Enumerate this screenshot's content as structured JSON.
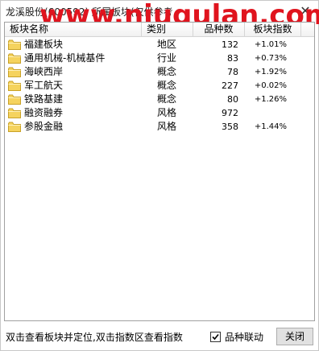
{
  "window": {
    "title": "龙溪股份(600592)  所属板块(仅供参考",
    "close_glyph": "✕"
  },
  "watermark": "www.niugulan.com",
  "columns": {
    "name": "板块名称",
    "category": "类别",
    "count": "品种数",
    "index": "板块指数"
  },
  "rows": [
    {
      "name": "福建板块",
      "category": "地区",
      "count": "132",
      "index": "+1.01%"
    },
    {
      "name": "通用机械-机械基件",
      "category": "行业",
      "count": "83",
      "index": "+0.73%"
    },
    {
      "name": "海峡西岸",
      "category": "概念",
      "count": "78",
      "index": "+1.92%"
    },
    {
      "name": "军工航天",
      "category": "概念",
      "count": "227",
      "index": "+0.02%"
    },
    {
      "name": "铁路基建",
      "category": "概念",
      "count": "80",
      "index": "+1.26%"
    },
    {
      "name": "融资融券",
      "category": "风格",
      "count": "972",
      "index": ""
    },
    {
      "name": "参股金融",
      "category": "风格",
      "count": "358",
      "index": "+1.44%"
    }
  ],
  "footer": {
    "hint": "双击查看板块并定位,双击指数区查看指数",
    "checkbox_label": "品种联动",
    "checkbox_checked": true,
    "close_label": "关闭"
  },
  "colors": {
    "folder": "#f5d35e",
    "watermark": "#e0141e"
  }
}
